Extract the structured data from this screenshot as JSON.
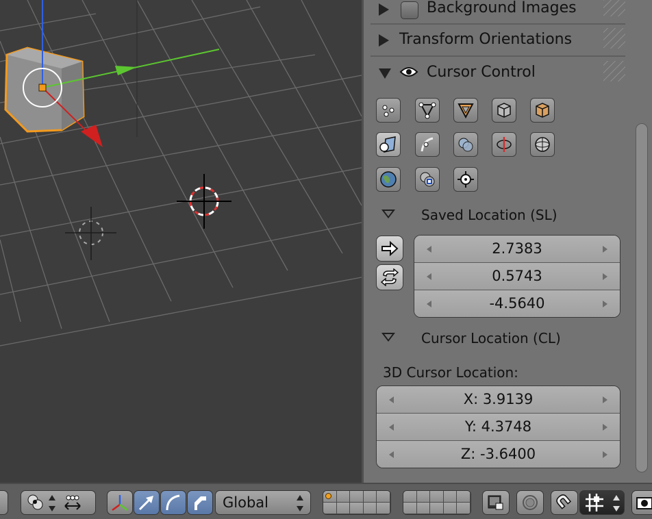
{
  "panel": {
    "sections": {
      "background_images": "Background Images",
      "transform_orientations": "Transform Orientations",
      "cursor_control": "Cursor Control"
    },
    "saved_location": {
      "title": "Saved Location (SL)",
      "values": [
        "2.7383",
        "0.5743",
        "-4.5640"
      ]
    },
    "cursor_location": {
      "title": "Cursor Location (CL)",
      "label": "3D Cursor Location:",
      "x": "X: 3.9139",
      "y": "Y: 4.3748",
      "z": "Z: -3.6400"
    }
  },
  "footer": {
    "orientation": "Global"
  },
  "colors": {
    "selection_outline": "#f39a1e",
    "axis_x": "#d02020",
    "axis_y": "#5cc630",
    "axis_z": "#3060e0"
  }
}
